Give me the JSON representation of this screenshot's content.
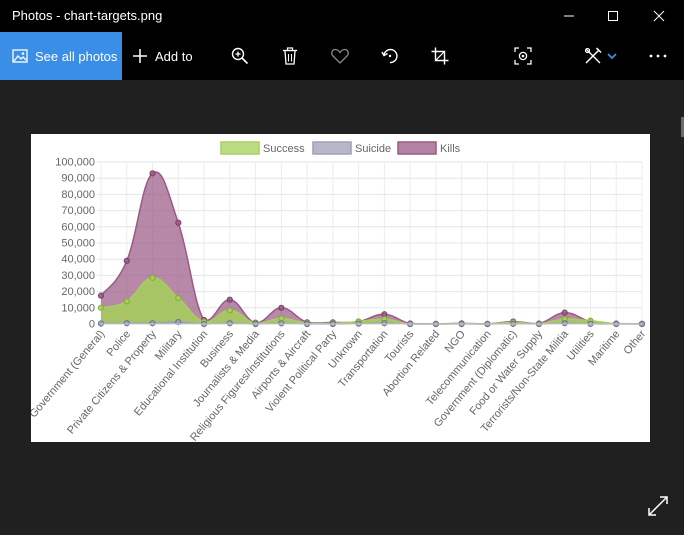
{
  "window": {
    "title": "Photos - chart-targets.png"
  },
  "toolbar": {
    "see_all_label": "See all photos",
    "add_to_label": "Add to",
    "icons": [
      "zoom-icon",
      "delete-icon",
      "favorite-icon",
      "rotate-icon",
      "crop-icon",
      "visual-search-icon",
      "edit-icon",
      "more-icon"
    ],
    "accent": "#3a8ee6"
  },
  "chart_data": {
    "type": "area",
    "categories": [
      "Government (General)",
      "Police",
      "Private Citizens & Property",
      "Military",
      "Educational Institution",
      "Business",
      "Journalists & Media",
      "Religious Figures/Institutions",
      "Airports & Aircraft",
      "Violent Political Party",
      "Unknown",
      "Transportation",
      "Tourists",
      "Abortion Related",
      "NGO",
      "Telecommunication",
      "Government (Diplomatic)",
      "Food or Water Supply",
      "Terrorists/Non-State Militia",
      "Utilities",
      "Maritime",
      "Other"
    ],
    "series": [
      {
        "name": "Success",
        "color": "#a6d05a",
        "values": [
          10000,
          14000,
          28500,
          16000,
          1500,
          8500,
          500,
          3500,
          500,
          500,
          1500,
          3000,
          0,
          0,
          200,
          0,
          1000,
          200,
          3000,
          2000,
          200,
          100
        ]
      },
      {
        "name": "Suicide",
        "color": "#9e9fb5",
        "values": [
          300,
          500,
          500,
          1200,
          0,
          500,
          0,
          400,
          0,
          0,
          200,
          500,
          0,
          0,
          0,
          0,
          100,
          0,
          500,
          100,
          0,
          0
        ]
      },
      {
        "name": "Kills",
        "color": "#9b5a86",
        "values": [
          17500,
          39000,
          93000,
          62500,
          2500,
          15000,
          800,
          10000,
          1000,
          1000,
          1500,
          6000,
          300,
          100,
          400,
          100,
          1500,
          300,
          7000,
          1500,
          300,
          200
        ]
      }
    ],
    "y_ticks": [
      "0",
      "10,000",
      "20,000",
      "30,000",
      "40,000",
      "50,000",
      "60,000",
      "70,000",
      "80,000",
      "90,000",
      "100,000"
    ],
    "ylim": [
      0,
      100000
    ],
    "grid": true,
    "legend": "top"
  }
}
